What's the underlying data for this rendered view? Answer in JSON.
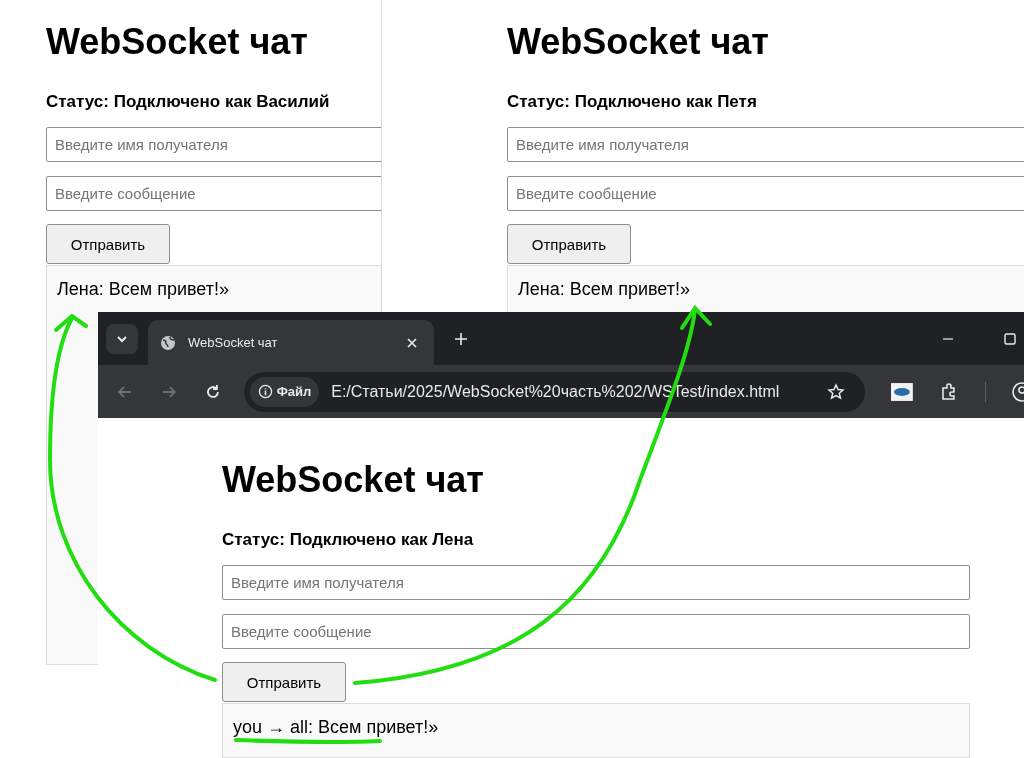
{
  "background_windows": [
    {
      "heading": "WebSocket чат",
      "status": "Статус: Подключено как Василий",
      "recipient_placeholder": "Введите имя получателя",
      "message_placeholder": "Введите сообщение",
      "send_button": "Отправить",
      "messages": [
        "Лена: Всем привет!»"
      ]
    },
    {
      "heading": "WebSocket чат",
      "status": "Статус: Подключено как Петя",
      "recipient_placeholder": "Введите имя получателя",
      "message_placeholder": "Введите сообщение",
      "send_button": "Отправить",
      "messages": [
        "Лена: Всем привет!»"
      ]
    }
  ],
  "browser": {
    "tab_title": "WebSocket чат",
    "site_chip": "Файл",
    "url": "E:/Статьи/2025/WebSocket%20часть%202/WSTest/index.html",
    "page": {
      "heading": "WebSocket чат",
      "status": "Статус: Подключено как Лена",
      "recipient_placeholder": "Введите имя получателя",
      "message_placeholder": "Введите сообщение",
      "send_button": "Отправить",
      "messages": [
        "you → all: Всем привет!»"
      ]
    }
  }
}
